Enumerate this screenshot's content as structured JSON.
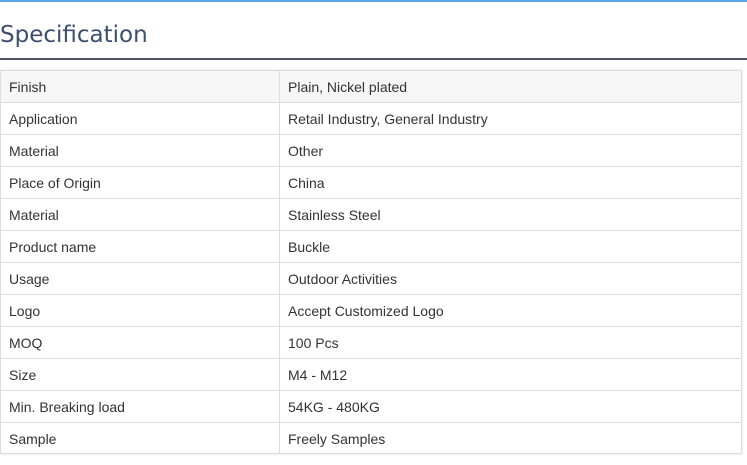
{
  "section": {
    "title": "Specification"
  },
  "spec_rows": [
    {
      "key": "Finish",
      "value": "Plain, Nickel plated"
    },
    {
      "key": "Application",
      "value": "Retail Industry, General Industry"
    },
    {
      "key": "Material",
      "value": "Other"
    },
    {
      "key": "Place of Origin",
      "value": "China"
    },
    {
      "key": "Material",
      "value": "Stainless Steel"
    },
    {
      "key": "Product name",
      "value": "Buckle"
    },
    {
      "key": "Usage",
      "value": "Outdoor Activities"
    },
    {
      "key": "Logo",
      "value": "Accept Customized Logo"
    },
    {
      "key": "MOQ",
      "value": "100 Pcs"
    },
    {
      "key": "Size",
      "value": "M4 - M12"
    },
    {
      "key": "Min. Breaking load",
      "value": "54KG - 480KG"
    },
    {
      "key": "Sample",
      "value": "Freely Samples"
    }
  ]
}
